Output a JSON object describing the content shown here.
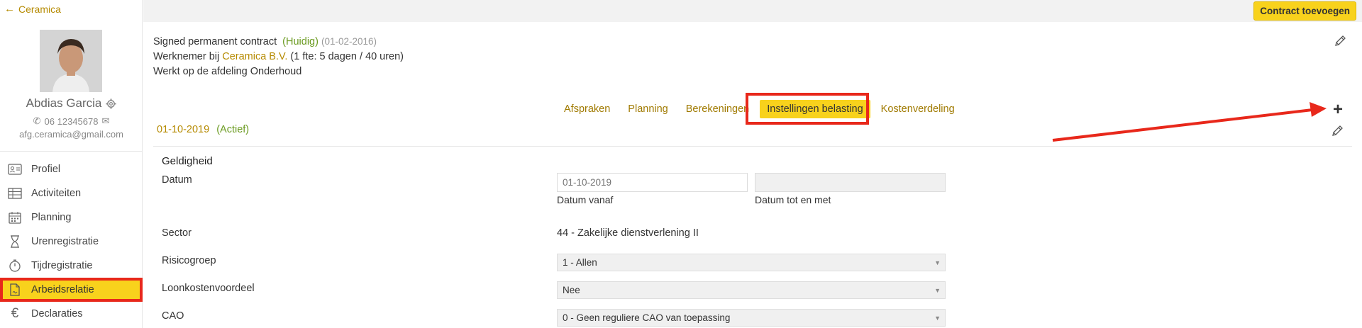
{
  "sidebar": {
    "back_label": "Ceramica",
    "user": {
      "name": "Abdias Garcia",
      "phone": "06 12345678",
      "email": "afg.ceramica@gmail.com"
    },
    "nav": [
      {
        "label": "Profiel",
        "icon": "profile-card-icon"
      },
      {
        "label": "Activiteiten",
        "icon": "table-icon"
      },
      {
        "label": "Planning",
        "icon": "calendar-icon"
      },
      {
        "label": "Urenregistratie",
        "icon": "hourglass-icon"
      },
      {
        "label": "Tijdregistratie",
        "icon": "stopwatch-icon"
      },
      {
        "label": "Arbeidsrelatie",
        "icon": "document-icon",
        "active": true
      },
      {
        "label": "Declaraties",
        "icon": "euro-icon"
      }
    ]
  },
  "toolbar": {
    "add_contract_label": "Contract toevoegen"
  },
  "contract": {
    "title": "Signed permanent contract",
    "status": "(Huidig)",
    "date": "(01-02-2016)",
    "employee_prefix": "Werknemer bij",
    "company": "Ceramica B.V.",
    "fte": "(1 fte: 5 dagen / 40 uren)",
    "department": "Werkt op de afdeling Onderhoud"
  },
  "tabs": [
    {
      "label": "Afspraken"
    },
    {
      "label": "Planning"
    },
    {
      "label": "Berekeningen"
    },
    {
      "label": "Instellingen belasting",
      "active": true
    },
    {
      "label": "Kostenverdeling"
    }
  ],
  "period": {
    "date": "01-10-2019",
    "state": "(Actief)"
  },
  "form": {
    "section_title": "Geldigheid",
    "datum_label": "Datum",
    "date_from_placeholder": "01-10-2019",
    "date_to_placeholder": "",
    "date_from_hint": "Datum vanaf",
    "date_to_hint": "Datum tot en met",
    "sector_label": "Sector",
    "sector_value": "44 - Zakelijke dienstverlening II",
    "risk_label": "Risicogroep",
    "risk_value": "1 - Allen",
    "wage_label": "Loonkostenvoordeel",
    "wage_value": "Nee",
    "cao_label": "CAO",
    "cao_value": "0 - Geen reguliere CAO van toepassing"
  },
  "colors": {
    "accent": "#f8d21c",
    "link": "#b58a00",
    "status_green": "#6a9a1f",
    "annotation_red": "#e8281b"
  }
}
